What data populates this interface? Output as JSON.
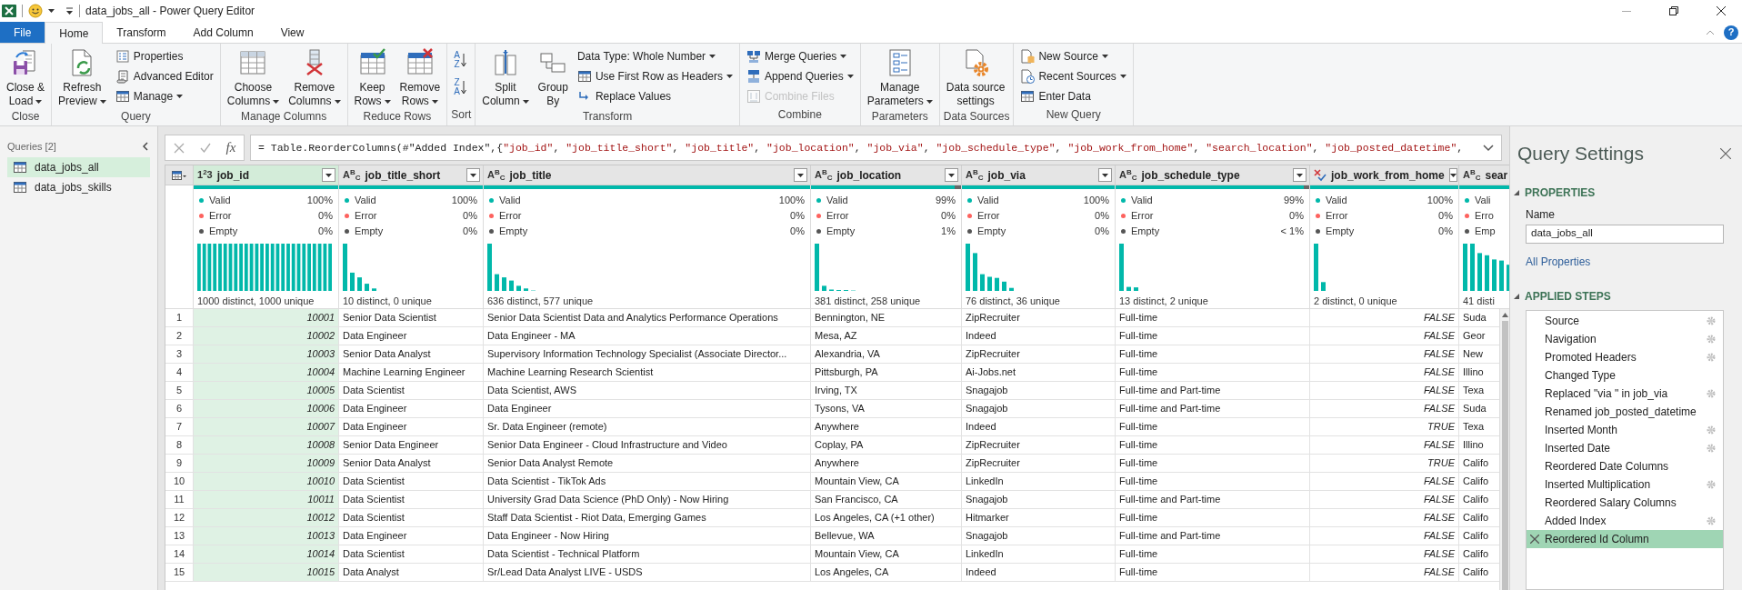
{
  "window": {
    "title": "data_jobs_all - Power Query Editor",
    "help": "?"
  },
  "ribbon": {
    "tabs": [
      {
        "label": "File",
        "kind": "file",
        "selected": false
      },
      {
        "label": "Home",
        "kind": "tab",
        "selected": true
      },
      {
        "label": "Transform",
        "kind": "tab",
        "selected": false
      },
      {
        "label": "Add Column",
        "kind": "tab",
        "selected": false
      },
      {
        "label": "View",
        "kind": "tab",
        "selected": false
      }
    ],
    "groups": [
      {
        "label": "Close",
        "items": [
          {
            "kind": "large",
            "lines": [
              "Close &",
              "Load"
            ],
            "dropdown": true,
            "disabled": false
          }
        ]
      },
      {
        "label": "Query",
        "items": [
          {
            "kind": "large",
            "lines": [
              "Refresh",
              "Preview"
            ],
            "dropdown": true,
            "disabled": false
          },
          {
            "kind": "small",
            "label": "Properties",
            "dropdown": false,
            "disabled": false
          },
          {
            "kind": "small",
            "label": "Advanced Editor",
            "dropdown": false,
            "disabled": false
          },
          {
            "kind": "small",
            "label": "Manage",
            "dropdown": true,
            "disabled": false
          }
        ]
      },
      {
        "label": "Manage Columns",
        "items": [
          {
            "kind": "large",
            "lines": [
              "Choose",
              "Columns"
            ],
            "dropdown": true,
            "disabled": false
          },
          {
            "kind": "large",
            "lines": [
              "Remove",
              "Columns"
            ],
            "dropdown": true,
            "disabled": false
          }
        ]
      },
      {
        "label": "Reduce Rows",
        "items": [
          {
            "kind": "large",
            "lines": [
              "Keep",
              "Rows"
            ],
            "dropdown": true,
            "disabled": false
          },
          {
            "kind": "large",
            "lines": [
              "Remove",
              "Rows"
            ],
            "dropdown": true,
            "disabled": false
          }
        ]
      },
      {
        "label": "Sort",
        "items": [
          {
            "kind": "sort",
            "top": "A",
            "bottom": "Z",
            "disabled": false
          },
          {
            "kind": "sort",
            "top": "Z",
            "bottom": "A",
            "disabled": false
          }
        ]
      },
      {
        "label": "Transform",
        "items": [
          {
            "kind": "large",
            "lines": [
              "Split",
              "Column"
            ],
            "dropdown": true,
            "disabled": false
          },
          {
            "kind": "large",
            "lines": [
              "Group",
              "By"
            ],
            "dropdown": false,
            "disabled": false
          },
          {
            "kind": "small",
            "label": "Data Type: Whole Number",
            "dropdown": true,
            "disabled": false
          },
          {
            "kind": "small",
            "label": "Use First Row as Headers",
            "dropdown": true,
            "disabled": false
          },
          {
            "kind": "small",
            "label": "Replace Values",
            "dropdown": false,
            "disabled": false
          }
        ]
      },
      {
        "label": "Combine",
        "items": [
          {
            "kind": "small",
            "label": "Merge Queries",
            "dropdown": true,
            "disabled": false
          },
          {
            "kind": "small",
            "label": "Append Queries",
            "dropdown": true,
            "disabled": false
          },
          {
            "kind": "small",
            "label": "Combine Files",
            "dropdown": false,
            "disabled": true
          }
        ]
      },
      {
        "label": "Parameters",
        "items": [
          {
            "kind": "large",
            "lines": [
              "Manage",
              "Parameters"
            ],
            "dropdown": true,
            "disabled": false
          }
        ]
      },
      {
        "label": "Data Sources",
        "items": [
          {
            "kind": "large",
            "lines": [
              "Data source",
              "settings"
            ],
            "dropdown": false,
            "disabled": false
          }
        ]
      },
      {
        "label": "New Query",
        "items": [
          {
            "kind": "small",
            "label": "New Source",
            "dropdown": true,
            "disabled": false
          },
          {
            "kind": "small",
            "label": "Recent Sources",
            "dropdown": true,
            "disabled": false
          },
          {
            "kind": "small",
            "label": "Enter Data",
            "dropdown": false,
            "disabled": false
          }
        ]
      }
    ]
  },
  "queries": {
    "header": "Queries [2]",
    "items": [
      {
        "label": "data_jobs_all",
        "selected": true
      },
      {
        "label": "data_jobs_skills",
        "selected": false
      }
    ]
  },
  "formula_bar": {
    "fx": "fx",
    "formula": "= Table.ReorderColumns(#\"Added Index\",{\"job_id\", \"job_title_short\", \"job_title\", \"job_location\", \"job_via\", \"job_schedule_type\", \"job_work_from_home\", \"search_location\", \"job_posted_datetime\","
  },
  "table": {
    "columns": [
      {
        "name": "job_id",
        "kind": "number",
        "type_glyph": "1$^{2}$3",
        "selected": true,
        "level": 1,
        "profile": [
          {
            "label": "Valid",
            "value": "100%",
            "color": "#01b8aa"
          },
          {
            "label": "Error",
            "value": "0%",
            "color": "#fd625e"
          },
          {
            "label": "Empty",
            "value": "0%",
            "color": "#555555"
          }
        ],
        "stats": "1000 distinct, 1000 unique"
      },
      {
        "name": "job_title_short",
        "kind": "text",
        "type_glyph": "A$^{B}$$_{C}$",
        "selected": false,
        "level": 1,
        "profile": [
          {
            "label": "Valid",
            "value": "100%",
            "color": "#01b8aa"
          },
          {
            "label": "Error",
            "value": "0%",
            "color": "#fd625e"
          },
          {
            "label": "Empty",
            "value": "0%",
            "color": "#555555"
          }
        ],
        "stats": "10 distinct, 0 unique"
      },
      {
        "name": "job_title",
        "kind": "text",
        "type_glyph": "A$^{B}$$_{C}$",
        "selected": false,
        "level": 1,
        "profile": [
          {
            "label": "Valid",
            "value": "100%",
            "color": "#01b8aa"
          },
          {
            "label": "Error",
            "value": "0%",
            "color": "#fd625e"
          },
          {
            "label": "Empty",
            "value": "0%",
            "color": "#555555"
          }
        ],
        "stats": "636 distinct, 577 unique"
      },
      {
        "name": "job_location",
        "kind": "text",
        "type_glyph": "A$^{B}$$_{C}$",
        "selected": false,
        "level": 0.96,
        "profile": [
          {
            "label": "Valid",
            "value": "99%",
            "color": "#01b8aa"
          },
          {
            "label": "Error",
            "value": "0%",
            "color": "#fd625e"
          },
          {
            "label": "Empty",
            "value": "1%",
            "color": "#555555"
          }
        ],
        "stats": "381 distinct, 258 unique"
      },
      {
        "name": "job_via",
        "kind": "text",
        "type_glyph": "A$^{B}$$_{C}$",
        "selected": false,
        "level": 1,
        "profile": [
          {
            "label": "Valid",
            "value": "100%",
            "color": "#01b8aa"
          },
          {
            "label": "Error",
            "value": "0%",
            "color": "#fd625e"
          },
          {
            "label": "Empty",
            "value": "0%",
            "color": "#555555"
          }
        ],
        "stats": "76 distinct, 36 unique"
      },
      {
        "name": "job_schedule_type",
        "kind": "text",
        "type_glyph": "A$^{B}$$_{C}$",
        "selected": false,
        "level": 0.97,
        "profile": [
          {
            "label": "Valid",
            "value": "99%",
            "color": "#01b8aa"
          },
          {
            "label": "Error",
            "value": "0%",
            "color": "#fd625e"
          },
          {
            "label": "Empty",
            "value": "< 1%",
            "color": "#555555"
          }
        ],
        "stats": "13 distinct, 2 unique"
      },
      {
        "name": "job_work_from_home",
        "kind": "any",
        "selected": false,
        "level": 1,
        "profile": [
          {
            "label": "Valid",
            "value": "100%",
            "color": "#01b8aa"
          },
          {
            "label": "Error",
            "value": "0%",
            "color": "#fd625e"
          },
          {
            "label": "Empty",
            "value": "0%",
            "color": "#555555"
          }
        ],
        "stats": "2 distinct, 0 unique"
      },
      {
        "name": "sear",
        "kind": "text",
        "type_glyph": "A$^{B}$$_{C}$",
        "selected": false,
        "level": 1,
        "profile": [
          {
            "label": "Vali",
            "color": "#01b8aa"
          },
          {
            "label": "Erro",
            "color": "#fd625e"
          },
          {
            "label": "Emp",
            "color": "#555555"
          }
        ],
        "stats": "41 disti"
      }
    ],
    "rows": [
      {
        "number": "1",
        "cells": [
          "10001",
          "Senior Data Scientist",
          "Senior Data Scientist Data and Analytics Performance Operations",
          "Bennington, NE",
          "ZipRecruiter",
          "Full-time",
          "FALSE",
          "Suda"
        ]
      },
      {
        "number": "2",
        "cells": [
          "10002",
          "Data Engineer",
          "Data Engineer - MA",
          "Mesa, AZ",
          "Indeed",
          "Full-time",
          "FALSE",
          "Geor"
        ]
      },
      {
        "number": "3",
        "cells": [
          "10003",
          "Senior Data Analyst",
          "Supervisory Information Technology Specialist (Associate Director...",
          "Alexandria, VA",
          "ZipRecruiter",
          "Full-time",
          "FALSE",
          "New"
        ]
      },
      {
        "number": "4",
        "cells": [
          "10004",
          "Machine Learning Engineer",
          "Machine Learning Research Scientist",
          "Pittsburgh, PA",
          "Ai-Jobs.net",
          "Full-time",
          "FALSE",
          "Illino"
        ]
      },
      {
        "number": "5",
        "cells": [
          "10005",
          "Data Scientist",
          "Data Scientist, AWS",
          "Irving, TX",
          "Snagajob",
          "Full-time and Part-time",
          "FALSE",
          "Texa"
        ]
      },
      {
        "number": "6",
        "cells": [
          "10006",
          "Data Engineer",
          "Data Engineer",
          "Tysons, VA",
          "Snagajob",
          "Full-time and Part-time",
          "FALSE",
          "Suda"
        ]
      },
      {
        "number": "7",
        "cells": [
          "10007",
          "Data Engineer",
          "Sr. Data Engineer (remote)",
          "Anywhere",
          "Indeed",
          "Full-time",
          "TRUE",
          "Texa"
        ]
      },
      {
        "number": "8",
        "cells": [
          "10008",
          "Senior Data Engineer",
          "Senior Data Engineer - Cloud Infrastructure and Video",
          "Coplay, PA",
          "ZipRecruiter",
          "Full-time",
          "FALSE",
          "Illino"
        ]
      },
      {
        "number": "9",
        "cells": [
          "10009",
          "Senior Data Analyst",
          "Senior Data Analyst Remote",
          "Anywhere",
          "ZipRecruiter",
          "Full-time",
          "TRUE",
          "Califo"
        ]
      },
      {
        "number": "10",
        "cells": [
          "10010",
          "Data Scientist",
          "Data Scientist - TikTok Ads",
          "Mountain View, CA",
          "LinkedIn",
          "Full-time",
          "FALSE",
          "Califo"
        ]
      },
      {
        "number": "11",
        "cells": [
          "10011",
          "Data Scientist",
          "University Grad Data Science (PhD Only) - Now Hiring",
          "San Francisco, CA",
          "Snagajob",
          "Full-time and Part-time",
          "FALSE",
          "Califo"
        ]
      },
      {
        "number": "12",
        "cells": [
          "10012",
          "Data Scientist",
          "Staff Data Scientist - Riot Data, Emerging Games",
          "Los Angeles, CA (+1 other)",
          "Hitmarker",
          "Full-time",
          "FALSE",
          "Califo"
        ]
      },
      {
        "number": "13",
        "cells": [
          "10013",
          "Data Engineer",
          "Data Engineer - Now Hiring",
          "Bellevue, WA",
          "Snagajob",
          "Full-time and Part-time",
          "FALSE",
          "Califo"
        ]
      },
      {
        "number": "14",
        "cells": [
          "10014",
          "Data Scientist",
          "Data Scientist - Technical Platform",
          "Mountain View, CA",
          "LinkedIn",
          "Full-time",
          "FALSE",
          "Califo"
        ]
      },
      {
        "number": "15",
        "cells": [
          "10015",
          "Data Analyst",
          "Sr/Lead Data Analyst LIVE - USDS",
          "Los Angeles, CA",
          "Indeed",
          "Full-time",
          "FALSE",
          "Califo"
        ]
      }
    ]
  },
  "query_settings": {
    "title": "Query Settings",
    "properties_header": "PROPERTIES",
    "name_label": "Name",
    "name_value": "data_jobs_all",
    "all_properties": "All Properties",
    "steps_header": "APPLIED STEPS",
    "steps": [
      {
        "label": "Source",
        "has_settings": true,
        "selected": false
      },
      {
        "label": "Navigation",
        "has_settings": true,
        "selected": false
      },
      {
        "label": "Promoted Headers",
        "has_settings": true,
        "selected": false
      },
      {
        "label": "Changed Type",
        "has_settings": false,
        "selected": false
      },
      {
        "label": "Replaced \"via \" in job_via",
        "has_settings": true,
        "selected": false
      },
      {
        "label": "Renamed job_posted_datetime",
        "has_settings": false,
        "selected": false
      },
      {
        "label": "Inserted Month",
        "has_settings": true,
        "selected": false
      },
      {
        "label": "Inserted Date",
        "has_settings": true,
        "selected": false
      },
      {
        "label": "Reordered Date Columns",
        "has_settings": false,
        "selected": false
      },
      {
        "label": "Inserted Multiplication",
        "has_settings": true,
        "selected": false
      },
      {
        "label": "Reordered Salary Columns",
        "has_settings": false,
        "selected": false
      },
      {
        "label": "Added Index",
        "has_settings": true,
        "selected": false
      },
      {
        "label": "Reordered Id Column",
        "has_settings": false,
        "selected": true
      }
    ]
  }
}
